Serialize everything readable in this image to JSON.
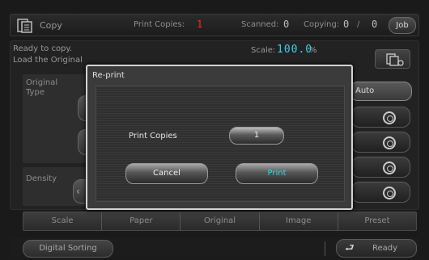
{
  "header": {
    "title": "Copy",
    "print_copies_label": "Print Copies:",
    "print_copies_value": "1",
    "scanned_label": "Scanned:",
    "scanned_value": "0",
    "copying_label": "Copying:",
    "copying_value": "0",
    "copying_sep": "/",
    "copying_total": "0",
    "job_label": "Job"
  },
  "status": {
    "line1": "Ready to copy.",
    "line2": "Load the Original",
    "scale_label": "Scale:",
    "scale_value": "100.0",
    "scale_unit": "%"
  },
  "left": {
    "original_type_label": "Original Type",
    "density_label": "Density"
  },
  "right": {
    "auto_label": "Auto"
  },
  "tabs": [
    "Scale",
    "Paper",
    "Original",
    "Image",
    "Preset"
  ],
  "bottom": {
    "digital_sorting": "Digital Sorting",
    "ready": "Ready"
  },
  "dialog": {
    "title": "Re-print",
    "print_copies_label": "Print Copies",
    "print_copies_value": "1",
    "cancel_label": "Cancel",
    "print_label": "Print"
  },
  "icons": [
    "copy-icon",
    "copy-settings-icon",
    "ring-icon",
    "return-arrow-icon"
  ],
  "colors": {
    "accent_cyan": "#3fd0e8",
    "counter_red": "#ff2a2a"
  }
}
